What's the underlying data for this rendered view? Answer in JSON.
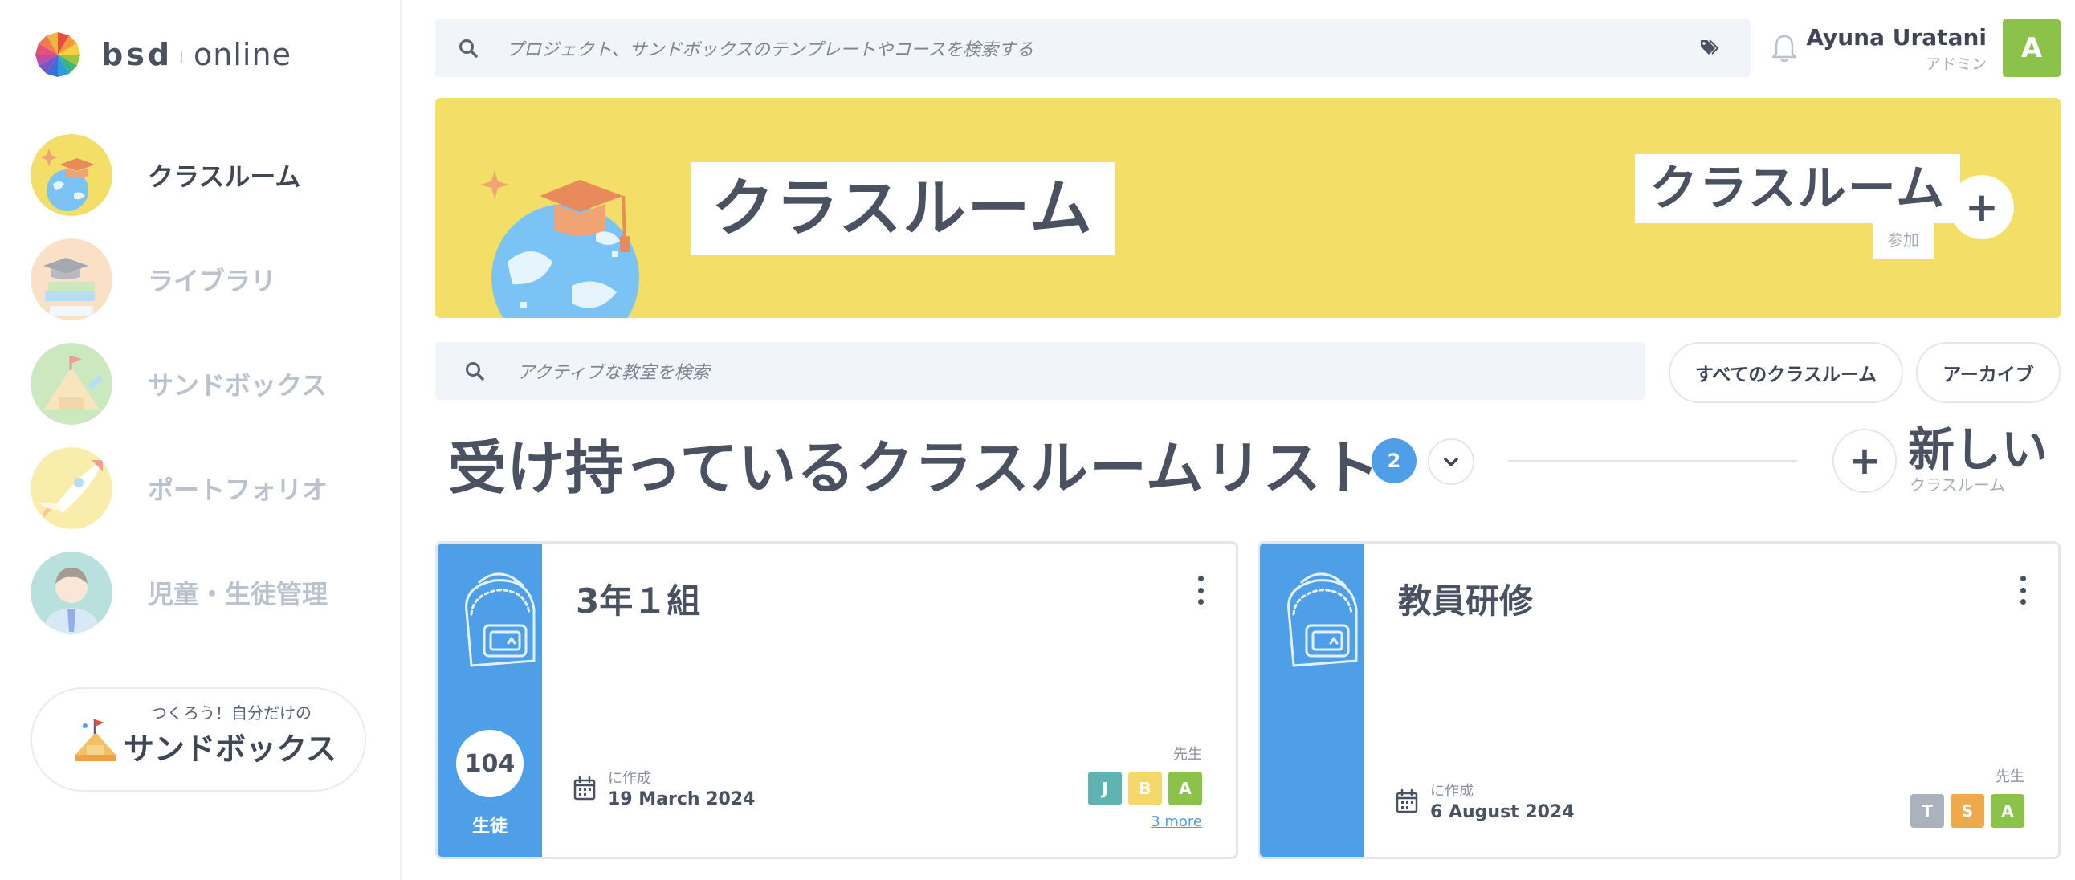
{
  "brand": {
    "name": "bsd",
    "suffix": "online"
  },
  "sidebar": {
    "items": [
      {
        "label": "クラスルーム",
        "icon": "globe-graduation-icon",
        "active": true
      },
      {
        "label": "ライブラリ",
        "icon": "books-icon",
        "active": false
      },
      {
        "label": "サンドボックス",
        "icon": "sandcastle-icon",
        "active": false
      },
      {
        "label": "ポートフォリオ",
        "icon": "rocket-icon",
        "active": false
      },
      {
        "label": "児童・生徒管理",
        "icon": "student-avatar-icon",
        "active": false
      }
    ],
    "sandbox_promo": {
      "small": "つくろう！自分だけの",
      "big": "サンドボックス",
      "icon": "sandcastle-flag-icon"
    }
  },
  "topbar": {
    "search_placeholder": "プロジェクト、サンドボックスのテンプレートやコースを検索する",
    "user_name": "Ayuna Uratani",
    "user_role": "アドミン",
    "user_initial": "A"
  },
  "banner": {
    "title": "クラスルーム",
    "join_title": "クラスルーム",
    "join_sub": "参加",
    "join_button": "+"
  },
  "classroom_search": {
    "placeholder": "アクティブな教室を検索",
    "filter_all": "すべてのクラスルーム",
    "filter_archive": "アーカイブ"
  },
  "list": {
    "title": "受け持っているクラスルームリスト",
    "count": "2",
    "new_button": "+",
    "new_title": "新しい",
    "new_sub": "クラスルーム"
  },
  "cards": [
    {
      "name": "3年１組",
      "student_count": "104",
      "student_label": "生徒",
      "created_label": "に作成",
      "created_date": "19 March 2024",
      "teachers_label": "先生",
      "teachers": [
        {
          "initial": "J",
          "color": "#5fb3b3"
        },
        {
          "initial": "B",
          "color": "#f4d86b"
        },
        {
          "initial": "A",
          "color": "#8bc34a"
        }
      ],
      "more": "3 more"
    },
    {
      "name": "教員研修",
      "created_label": "に作成",
      "created_date": "6 August 2024",
      "teachers_label": "先生",
      "teachers": [
        {
          "initial": "T",
          "color": "#a9b2bd"
        },
        {
          "initial": "S",
          "color": "#f0a94a"
        },
        {
          "initial": "A",
          "color": "#8bc34a"
        }
      ]
    }
  ],
  "colors": {
    "accent_blue": "#4f9fe8",
    "banner_yellow": "#f3df67",
    "avatar_green": "#8bc34a"
  }
}
